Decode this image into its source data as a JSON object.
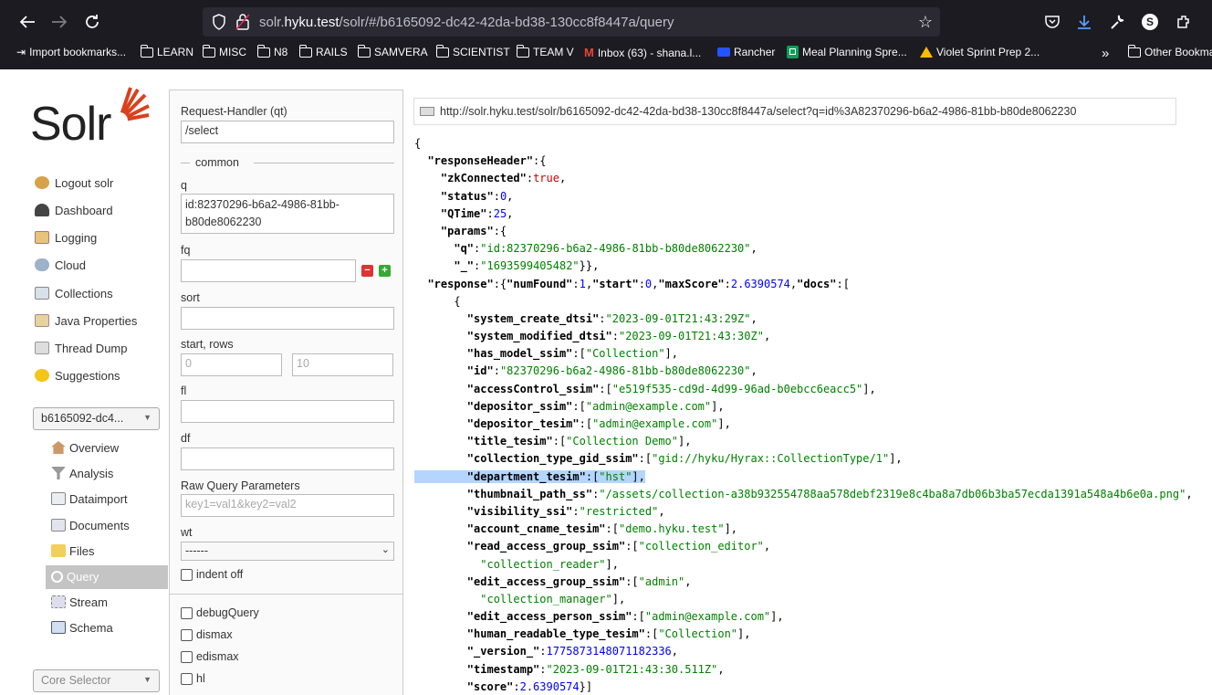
{
  "browser": {
    "url_host_prefix": "solr.",
    "url_host_bold": "hyku.test",
    "url_path": "/solr/#/b6165092-dc42-42da-bd38-130cc8f8447a/query",
    "bookmarks": [
      "Import bookmarks...",
      "LEARN",
      "MISC",
      "N8",
      "RAILS",
      "SAMVERA",
      "SCIENTIST",
      "TEAM V",
      "Inbox (63) - shana.l...",
      "Rancher",
      "Meal Planning Spre...",
      "Violet Sprint Prep 2...",
      "Other Bookma"
    ],
    "profile_initial": "S"
  },
  "logo": "Solr",
  "nav": [
    "Logout solr",
    "Dashboard",
    "Logging",
    "Cloud",
    "Collections",
    "Java Properties",
    "Thread Dump",
    "Suggestions"
  ],
  "core": {
    "selected": "b6165092-dc4...",
    "menu": [
      "Overview",
      "Analysis",
      "Dataimport",
      "Documents",
      "Files",
      "Query",
      "Stream",
      "Schema"
    ],
    "active": "Query",
    "core_selector": "Core Selector"
  },
  "form": {
    "qt_label": "Request-Handler (qt)",
    "qt_value": "/select",
    "common_legend": "common",
    "q_label": "q",
    "q_value": "id:82370296-b6a2-4986-81bb-b80de8062230",
    "fq_label": "fq",
    "sort_label": "sort",
    "start_rows_label": "start, rows",
    "start_placeholder": "0",
    "rows_placeholder": "10",
    "fl_label": "fl",
    "df_label": "df",
    "raw_label": "Raw Query Parameters",
    "raw_placeholder": "key1=val1&key2=val2",
    "wt_label": "wt",
    "wt_value": "------",
    "indent_label": "indent off",
    "checkboxes": [
      "debugQuery",
      "dismax",
      "edismax",
      "hl"
    ]
  },
  "result_url": "http://solr.hyku.test/solr/b6165092-dc42-42da-bd38-130cc8f8447a/select?q=id%3A82370296-b6a2-4986-81bb-b80de8062230",
  "json_lines": [
    "{",
    "  \"responseHeader\":{",
    "    \"zkConnected\":true,",
    "    \"status\":0,",
    "    \"QTime\":25,",
    "    \"params\":{",
    "      \"q\":\"id:82370296-b6a2-4986-81bb-b80de8062230\",",
    "      \"_\":\"1693599405482\"}},",
    "  \"response\":{\"numFound\":1,\"start\":0,\"maxScore\":2.6390574,\"docs\":[",
    "      {",
    "        \"system_create_dtsi\":\"2023-09-01T21:43:29Z\",",
    "        \"system_modified_dtsi\":\"2023-09-01T21:43:30Z\",",
    "        \"has_model_ssim\":[\"Collection\"],",
    "        \"id\":\"82370296-b6a2-4986-81bb-b80de8062230\",",
    "        \"accessControl_ssim\":[\"e519f535-cd9d-4d99-96ad-b0ebcc6eacc5\"],",
    "        \"depositor_ssim\":[\"admin@example.com\"],",
    "        \"depositor_tesim\":[\"admin@example.com\"],",
    "        \"title_tesim\":[\"Collection Demo\"],",
    "        \"collection_type_gid_ssim\":[\"gid://hyku/Hyrax::CollectionType/1\"],",
    "        \"department_tesim\":[\"hst\"],",
    "        \"thumbnail_path_ss\":\"/assets/collection-a38b932554788aa578debf2319e8c4ba8a7db06b3ba57ecda1391a548a4b6e0a.png\",",
    "        \"visibility_ssi\":\"restricted\",",
    "        \"account_cname_tesim\":[\"demo.hyku.test\"],",
    "        \"read_access_group_ssim\":[\"collection_editor\",",
    "          \"collection_reader\"],",
    "        \"edit_access_group_ssim\":[\"admin\",",
    "          \"collection_manager\"],",
    "        \"edit_access_person_ssim\":[\"admin@example.com\"],",
    "        \"human_readable_type_tesim\":[\"Collection\"],",
    "        \"_version_\":1775873148071182336,",
    "        \"timestamp\":\"2023-09-01T21:43:30.511Z\",",
    "        \"score\":2.6390574}]"
  ],
  "highlight_line": 19,
  "colors": {
    "browser_bg": "#1c1b22",
    "urlbar_bg": "#2b2a33",
    "selected_nav": "#c4c4c4",
    "json_string": "#008000",
    "json_number": "#0000ff",
    "json_bool": "#cc0000",
    "highlight": "#b4d5fe",
    "solr_red": "#d9411e"
  }
}
